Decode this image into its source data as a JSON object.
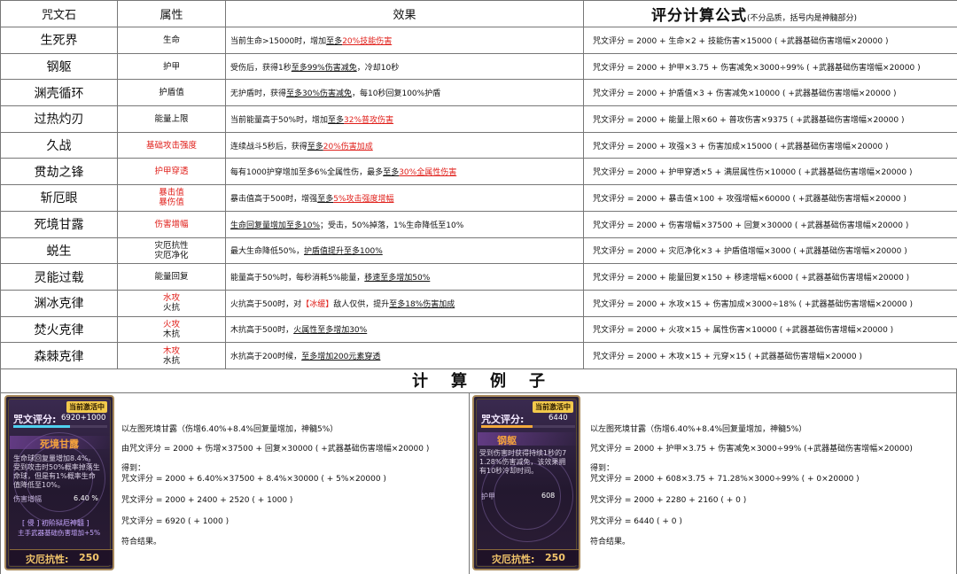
{
  "headers": {
    "name": "咒文石",
    "attr": "属性",
    "effect": "效果",
    "formula": "评分计算公式",
    "formula_note": "(不分品质，括号内是神髓部分)"
  },
  "rows": [
    {
      "name": "生死界",
      "attr": [
        "生命"
      ],
      "attr_red": [
        false
      ],
      "effect": [
        {
          "t": "当前生命>15000时，增加"
        },
        {
          "t": "至多",
          "s": "u"
        },
        {
          "t": "20%技能伤害",
          "s": "ur"
        }
      ],
      "formula": "咒文评分 = 2000 + 生命×2 + 技能伤害×15000 ( +武器基础伤害增幅×20000 )"
    },
    {
      "name": "钢躯",
      "attr": [
        "护甲"
      ],
      "attr_red": [
        false
      ],
      "effect": [
        {
          "t": "受伤后，获得1秒"
        },
        {
          "t": "至多99%伤害减免",
          "s": "u"
        },
        {
          "t": "，冷却10秒"
        }
      ],
      "formula": "咒文评分 = 2000 + 护甲×3.75 + 伤害减免×3000÷99% ( +武器基础伤害增幅×20000 )"
    },
    {
      "name": "渊壳循环",
      "attr": [
        "护盾值"
      ],
      "attr_red": [
        false
      ],
      "effect": [
        {
          "t": "无护盾时，获得"
        },
        {
          "t": "至多30%伤害减免",
          "s": "u"
        },
        {
          "t": "，每10秒回复100%护盾"
        }
      ],
      "formula": "咒文评分 = 2000 + 护盾值×3 + 伤害减免×10000 ( +武器基础伤害增幅×20000 )"
    },
    {
      "name": "过热灼刃",
      "attr": [
        "能量上限"
      ],
      "attr_red": [
        false
      ],
      "effect": [
        {
          "t": "当前能量高于50%时，增加"
        },
        {
          "t": "至多",
          "s": "u"
        },
        {
          "t": "32%普攻伤害",
          "s": "ur"
        }
      ],
      "formula": "咒文评分 = 2000 + 能量上限×60 + 普攻伤害×9375 ( +武器基础伤害增幅×20000 )"
    },
    {
      "name": "久战",
      "attr": [
        "基础攻击强度"
      ],
      "attr_red": [
        true
      ],
      "effect": [
        {
          "t": "连续战斗5秒后，获得"
        },
        {
          "t": "至多",
          "s": "u"
        },
        {
          "t": "20%伤害加成",
          "s": "ur"
        }
      ],
      "formula": "咒文评分 = 2000 + 攻强×3 + 伤害加成×15000 ( +武器基础伤害增幅×20000 )"
    },
    {
      "name": "贯劫之锋",
      "attr": [
        "护甲穿透"
      ],
      "attr_red": [
        true
      ],
      "effect": [
        {
          "t": "每有1000护穿增加至多6%全属性伤，最多"
        },
        {
          "t": "至多",
          "s": "u"
        },
        {
          "t": "30%全属性伤害",
          "s": "ur"
        }
      ],
      "formula": "咒文评分 = 2000 + 护甲穿透×5 + 满层属性伤×10000 ( +武器基础伤害增幅×20000 )"
    },
    {
      "name": "斩厄眼",
      "attr": [
        "暴击值",
        "暴伤值"
      ],
      "attr_red": [
        true,
        true
      ],
      "effect": [
        {
          "t": "暴击值高于500时，增强"
        },
        {
          "t": "至多",
          "s": "u"
        },
        {
          "t": "5%攻击强度增幅",
          "s": "ur"
        }
      ],
      "formula": "咒文评分 = 2000 + 暴击值×100 + 攻强增幅×60000 ( +武器基础伤害增幅×20000 )"
    },
    {
      "name": "死境甘露",
      "attr": [
        "伤害增幅"
      ],
      "attr_red": [
        true
      ],
      "effect": [
        {
          "t": "生命回复量增加至多10%",
          "s": "u"
        },
        {
          "t": "；受击，50%掉落，1%生命降低至10%"
        }
      ],
      "formula": "咒文评分 = 2000 + 伤害增幅×37500 + 回复×30000 ( +武器基础伤害增幅×20000 )"
    },
    {
      "name": "蜕生",
      "attr": [
        "灾厄抗性",
        "灾厄净化"
      ],
      "attr_red": [
        false,
        false
      ],
      "effect": [
        {
          "t": "最大生命降低50%，"
        },
        {
          "t": "护盾值提升至多100%",
          "s": "u"
        }
      ],
      "formula": "咒文评分 = 2000 + 灾厄净化×3 + 护盾值增幅×3000 ( +武器基础伤害增幅×20000 )"
    },
    {
      "name": "灵能过载",
      "attr": [
        "能量回复"
      ],
      "attr_red": [
        false
      ],
      "effect": [
        {
          "t": "能量高于50%时，每秒消耗5%能量，"
        },
        {
          "t": "移速至多增加50%",
          "s": "u"
        }
      ],
      "formula": "咒文评分 = 2000 + 能量回复×150 + 移速增幅×6000 ( +武器基础伤害增幅×20000 )"
    },
    {
      "name": "渊冰克律",
      "attr": [
        "水攻",
        "火抗"
      ],
      "attr_red": [
        true,
        false
      ],
      "effect": [
        {
          "t": "火抗高于500时，对"
        },
        {
          "t": "【冰缓】",
          "s": "rd"
        },
        {
          "t": "敌人仅供，提升"
        },
        {
          "t": "至多18%伤害加成",
          "s": "u"
        }
      ],
      "formula": "咒文评分 = 2000 + 水攻×15 + 伤害加成×3000÷18% ( +武器基础伤害增幅×20000 )"
    },
    {
      "name": "焚火克律",
      "attr": [
        "火攻",
        "木抗"
      ],
      "attr_red": [
        true,
        false
      ],
      "effect": [
        {
          "t": "木抗高于500时，"
        },
        {
          "t": "火属性至多增加30%",
          "s": "u"
        }
      ],
      "formula": "咒文评分 = 2000 + 火攻×15 + 属性伤害×10000 ( +武器基础伤害增幅×20000 )"
    },
    {
      "name": "森棘克律",
      "attr": [
        "木攻",
        "水抗"
      ],
      "attr_red": [
        true,
        false
      ],
      "effect": [
        {
          "t": "水抗高于200时候，"
        },
        {
          "t": "至多增加200元素穿透",
          "s": "u"
        }
      ],
      "formula": "咒文评分 = 2000 + 木攻×15 + 元穿×15 ( +武器基础伤害增幅×20000 )"
    }
  ],
  "example_title": "计算例子",
  "example_left": {
    "card": {
      "badge": "当前激活中",
      "score_label": "咒文评分:",
      "score_value": "6920+1000",
      "score_fill": 0.6,
      "name": "死境甘露",
      "desc": [
        "生命球回复量增加8.4%。",
        "受到攻击时50%概率掉落生",
        "命球，但是有1%概率生命",
        "值降低至10%。"
      ],
      "stat_label": "伤害增幅",
      "stat_value": "6.40 %",
      "divine_title": "[ 侵 ] 初阶狱厄神髓 ]",
      "divine_text": "主手武器基础伤害增加+5%",
      "resist_label": "灾厄抗性:",
      "resist_value": "250"
    },
    "lines": [
      "以左图死境甘露（伤增6.40%+8.4%回复量增加，神髓5%）",
      "由咒文评分 = 2000 + 伤增×37500 + 回复×30000 ( +武器基础伤害增幅×20000 )",
      "得到：",
      "咒文评分 = 2000 + 6.40%×37500 + 8.4%×30000 ( + 5%×20000 )",
      "咒文评分 = 2000 + 2400 + 2520 ( + 1000 )",
      "咒文评分 = 6920 ( + 1000 )",
      "符合结果。"
    ]
  },
  "example_right": {
    "card": {
      "badge": "当前激活中",
      "score_label": "咒文评分:",
      "score_value": "6440",
      "score_fill": 0.55,
      "name": "钢躯",
      "desc": [
        "受到伤害时获得持续1秒的7",
        "1.28%伤害减免，该效果拥",
        "有10秒冷却时间。"
      ],
      "stat_label": "护甲",
      "stat_value": "608",
      "resist_label": "灾厄抗性:",
      "resist_value": "250"
    },
    "lines": [
      "以左图死境甘露（伤增6.40%+8.4%回复量增加，神髓5%）",
      "咒文评分 = 2000 + 护甲×3.75 + 伤害减免×3000÷99% (+武器基础伤害增幅×20000)",
      "得到：",
      "咒文评分 = 2000 + 608×3.75 + 71.28%×3000÷99% ( + 0×20000 )",
      "咒文评分 = 2000 + 2280 + 2160 ( + 0 )",
      "咒文评分 = 6440 ( + 0 )",
      "符合结果。"
    ]
  }
}
